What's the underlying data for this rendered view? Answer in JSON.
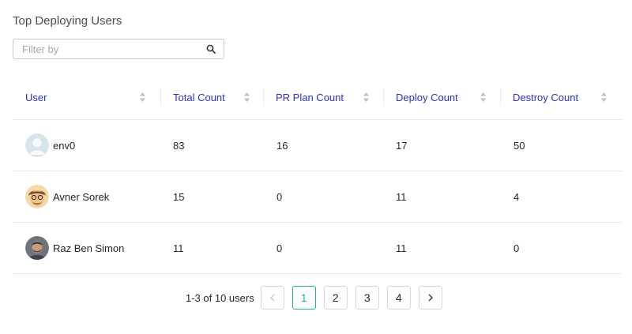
{
  "title": "Top Deploying Users",
  "filter": {
    "placeholder": "Filter by",
    "value": ""
  },
  "columns": [
    "User",
    "Total Count",
    "PR Plan Count",
    "Deploy Count",
    "Destroy Count"
  ],
  "rows": [
    {
      "user": "env0",
      "avatar": "default-avatar-icon",
      "total": "83",
      "pr_plan": "16",
      "deploy": "17",
      "destroy": "50"
    },
    {
      "user": "Avner Sorek",
      "avatar": "cartoon-avatar-icon",
      "total": "15",
      "pr_plan": "0",
      "deploy": "11",
      "destroy": "4"
    },
    {
      "user": "Raz Ben Simon",
      "avatar": "photo-avatar-icon",
      "total": "11",
      "pr_plan": "0",
      "deploy": "11",
      "destroy": "0"
    }
  ],
  "pagination": {
    "summary": "1-3 of 10 users",
    "pages": [
      "1",
      "2",
      "3",
      "4"
    ],
    "current": "1"
  },
  "colors": {
    "accent": "#1ab394",
    "header_text": "#2f2fc8"
  }
}
